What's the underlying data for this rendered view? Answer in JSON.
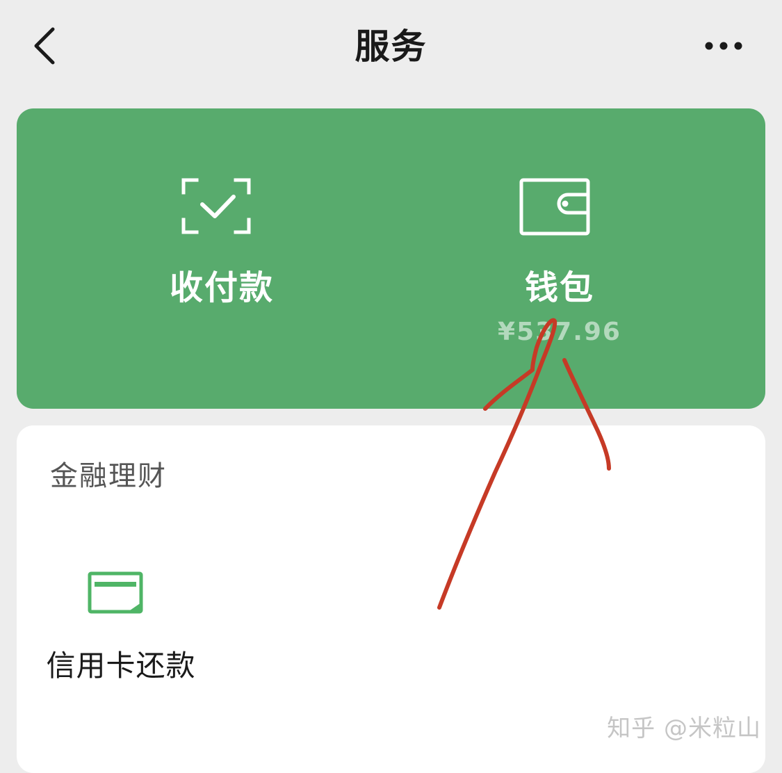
{
  "header": {
    "title": "服务",
    "back_icon": "chevron-left-icon",
    "more_icon": "more-dots-icon"
  },
  "primary_card": {
    "background_color": "#58ab6d",
    "items": [
      {
        "label": "收付款",
        "icon": "scan-check-icon"
      },
      {
        "label": "钱包",
        "icon": "wallet-icon",
        "balance": "¥537.96"
      }
    ]
  },
  "finance_section": {
    "title": "金融理财",
    "items": [
      {
        "label": "信用卡还款",
        "icon": "credit-card-icon",
        "icon_color": "#4fb566"
      }
    ]
  },
  "watermark": "知乎 @米粒山",
  "annotation_color": "#c63a26"
}
